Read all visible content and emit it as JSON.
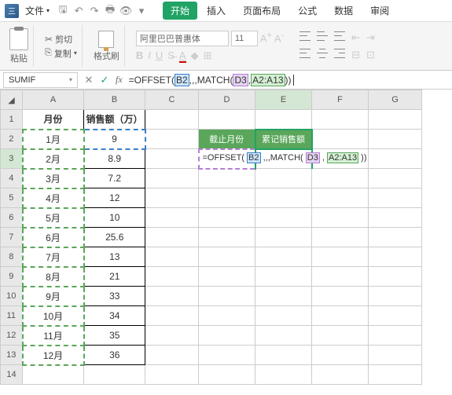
{
  "menubar": {
    "file": "文件"
  },
  "tabs": {
    "start": "开始",
    "insert": "插入",
    "layout": "页面布局",
    "formula": "公式",
    "data": "数据",
    "review": "审阅"
  },
  "ribbon": {
    "paste": "粘贴",
    "cut": "剪切",
    "copy": "复制",
    "fmtpaint": "格式刷",
    "font": "阿里巴巴普惠体",
    "size": "11"
  },
  "fbar": {
    "name": "SUMIF",
    "formula": "=OFFSET(B2,,,MATCH(D3,A2:A13))"
  },
  "colhdrs": {
    "A": "A",
    "B": "B",
    "C": "C",
    "D": "D",
    "E": "E",
    "F": "F",
    "G": "G"
  },
  "t": {
    "month": "月份",
    "sales": "销售额（万）",
    "cutoff": "截止月份",
    "cumul": "累记销售额"
  },
  "data": {
    "months": [
      "1月",
      "2月",
      "3月",
      "4月",
      "5月",
      "6月",
      "7月",
      "8月",
      "9月",
      "10月",
      "11月",
      "12月"
    ],
    "vals": [
      "9",
      "8.9",
      "7.2",
      "12",
      "10",
      "25.6",
      "13",
      "21",
      "33",
      "34",
      "35",
      "36"
    ]
  },
  "cellformula": "=OFFSET( B2 ,,,MATCH( D3 , A2:A13 ))"
}
